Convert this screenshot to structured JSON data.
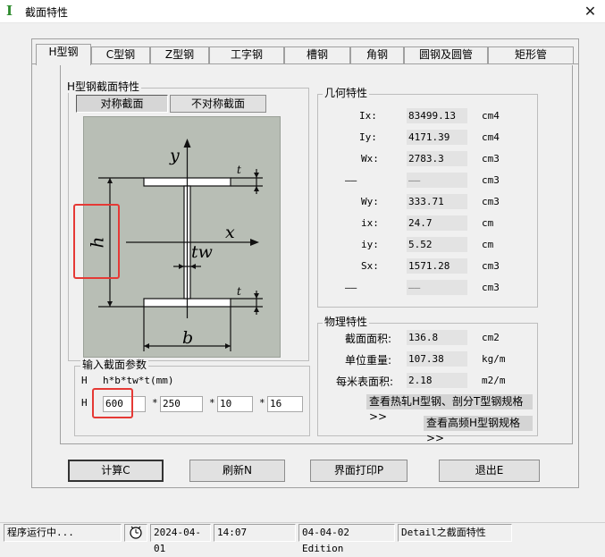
{
  "window": {
    "title": "截面特性",
    "app_icon": "I",
    "close_glyph": "✕"
  },
  "tabs": [
    {
      "label": "H型钢",
      "active": true
    },
    {
      "label": "C型钢"
    },
    {
      "label": "Z型钢"
    },
    {
      "label": "工字钢"
    },
    {
      "label": "槽钢"
    },
    {
      "label": "角钢"
    },
    {
      "label": "圆钢及圆管"
    },
    {
      "label": "矩形管"
    }
  ],
  "section_group": {
    "title": "H型钢截面特性",
    "symmetric_label": "对称截面",
    "asymmetric_label": "不对称截面"
  },
  "diagram": {
    "y_label": "y",
    "x_label": "x",
    "tw_label": "tw",
    "h_label": "h",
    "b_label": "b",
    "t_top": "t",
    "t_bottom": "t"
  },
  "input_group": {
    "title": "输入截面参数",
    "prefix": "H",
    "formula": "h*b*tw*t(mm)",
    "row_prefix": "H",
    "star": "*",
    "h": "600",
    "b": "250",
    "tw": "10",
    "t": "16"
  },
  "geometry": {
    "title": "几何特性",
    "rows": [
      {
        "label": "Ix:",
        "value": "83499.13",
        "unit": "cm4"
      },
      {
        "label": "Iy:",
        "value": "4171.39",
        "unit": "cm4"
      },
      {
        "label": "Wx:",
        "value": "2783.3",
        "unit": "cm3"
      },
      {
        "label": "——",
        "value": "——",
        "unit": "cm3"
      },
      {
        "label": "Wy:",
        "value": "333.71",
        "unit": "cm3"
      },
      {
        "label": "ix:",
        "value": "24.7",
        "unit": "cm"
      },
      {
        "label": "iy:",
        "value": "5.52",
        "unit": "cm"
      },
      {
        "label": "Sx:",
        "value": "1571.28",
        "unit": "cm3"
      },
      {
        "label": "——",
        "value": "——",
        "unit": "cm3"
      }
    ]
  },
  "physical": {
    "title": "物理特性",
    "rows": [
      {
        "label": "截面面积:",
        "value": "136.8",
        "unit": "cm2"
      },
      {
        "label": "单位重量:",
        "value": "107.38",
        "unit": "kg/m"
      },
      {
        "label": "每米表面积:",
        "value": "2.18",
        "unit": "m2/m"
      }
    ],
    "link_hot_rolled": "查看热轧H型钢、剖分T型钢规格>>",
    "link_high_freq": "查看高频H型钢规格>>"
  },
  "buttons": {
    "calc": "计算C",
    "refresh": "刷新N",
    "print": "界面打印P",
    "exit": "退出E"
  },
  "status": {
    "running": "程序运行中...",
    "date": "2024-04-01",
    "time": "14:07",
    "edition": "04-04-02 Edition",
    "detail": "Detail之截面特性"
  },
  "colors": {
    "highlight_red": "#e53935",
    "diagram_bg": "#b8beb5"
  }
}
